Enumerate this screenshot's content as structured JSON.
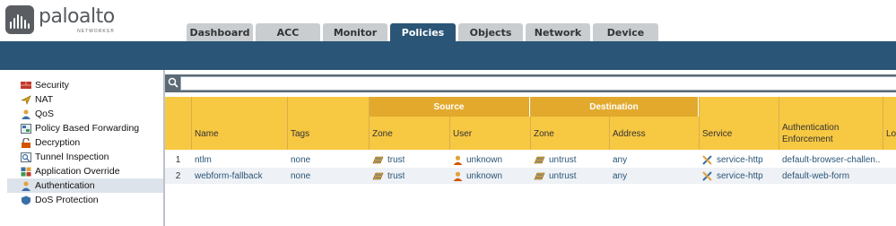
{
  "brand": {
    "name": "paloalto",
    "sub": "NETWORKS®"
  },
  "tabs": [
    {
      "label": "Dashboard",
      "active": false
    },
    {
      "label": "ACC",
      "active": false
    },
    {
      "label": "Monitor",
      "active": false
    },
    {
      "label": "Policies",
      "active": true
    },
    {
      "label": "Objects",
      "active": false
    },
    {
      "label": "Network",
      "active": false
    },
    {
      "label": "Device",
      "active": false
    }
  ],
  "sidebar": {
    "items": [
      {
        "label": "Security",
        "icon": "security-policy-icon",
        "active": false
      },
      {
        "label": "NAT",
        "icon": "nat-policy-icon",
        "active": false
      },
      {
        "label": "QoS",
        "icon": "qos-policy-icon",
        "active": false
      },
      {
        "label": "Policy Based Forwarding",
        "icon": "pbf-policy-icon",
        "active": false
      },
      {
        "label": "Decryption",
        "icon": "decryption-policy-icon",
        "active": false
      },
      {
        "label": "Tunnel Inspection",
        "icon": "tunnel-inspection-icon",
        "active": false
      },
      {
        "label": "Application Override",
        "icon": "application-override-icon",
        "active": false
      },
      {
        "label": "Authentication",
        "icon": "authentication-policy-icon",
        "active": true
      },
      {
        "label": "DoS Protection",
        "icon": "dos-protection-icon",
        "active": false
      }
    ]
  },
  "search": {
    "value": "",
    "placeholder": ""
  },
  "table": {
    "group_headers": {
      "source": "Source",
      "destination": "Destination"
    },
    "columns": {
      "name": "Name",
      "tags": "Tags",
      "src_zone": "Zone",
      "src_user": "User",
      "dst_zone": "Zone",
      "dst_address": "Address",
      "service": "Service",
      "auth_enforcement": "Authentication Enforcement",
      "log": "Lo"
    },
    "rows": [
      {
        "num": "1",
        "name": "ntlm",
        "tags": "none",
        "src_zone": "trust",
        "src_user": "unknown",
        "dst_zone": "untrust",
        "dst_address": "any",
        "service": "service-http",
        "auth_enforcement": "default-browser-challen..."
      },
      {
        "num": "2",
        "name": "webform-fallback",
        "tags": "none",
        "src_zone": "trust",
        "src_user": "unknown",
        "dst_zone": "untrust",
        "dst_address": "any",
        "service": "service-http",
        "auth_enforcement": "default-web-form"
      }
    ]
  },
  "colors": {
    "accent": "#2a5577",
    "header_yellow": "#f7c842",
    "group_orange": "#e2a92c",
    "tab_inactive": "#c9cdd0",
    "link": "#2a5577"
  }
}
